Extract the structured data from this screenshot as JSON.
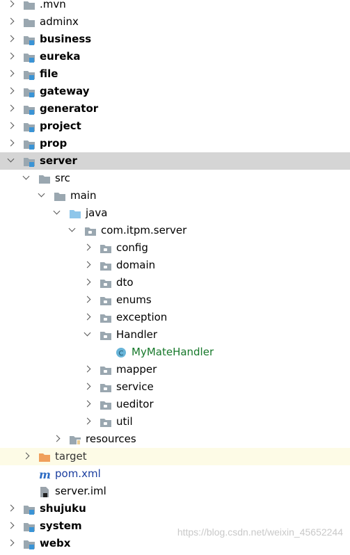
{
  "tree": {
    "rows": [
      {
        "label": "mvn",
        "display": ".mvn",
        "type": "folder",
        "expand": "collapsed",
        "level": 0,
        "bold": false
      },
      {
        "label": "adminx",
        "type": "folder",
        "expand": "collapsed",
        "level": 0,
        "bold": false
      },
      {
        "label": "business",
        "type": "module",
        "expand": "collapsed",
        "level": 0,
        "bold": true
      },
      {
        "label": "eureka",
        "type": "module",
        "expand": "collapsed",
        "level": 0,
        "bold": true
      },
      {
        "label": "file",
        "type": "module",
        "expand": "collapsed",
        "level": 0,
        "bold": true
      },
      {
        "label": "gateway",
        "type": "module",
        "expand": "collapsed",
        "level": 0,
        "bold": true
      },
      {
        "label": "generator",
        "type": "module",
        "expand": "collapsed",
        "level": 0,
        "bold": true
      },
      {
        "label": "project",
        "type": "module",
        "expand": "collapsed",
        "level": 0,
        "bold": true
      },
      {
        "label": "prop",
        "type": "module",
        "expand": "collapsed",
        "level": 0,
        "bold": true
      },
      {
        "label": "server",
        "type": "module",
        "expand": "expanded",
        "level": 0,
        "bold": true,
        "selected": true
      },
      {
        "label": "src",
        "type": "folder",
        "expand": "expanded",
        "level": 1,
        "bold": false
      },
      {
        "label": "main",
        "type": "folder",
        "expand": "expanded",
        "level": 2,
        "bold": false
      },
      {
        "label": "java",
        "type": "source",
        "expand": "expanded",
        "level": 3,
        "bold": false
      },
      {
        "label": "com.itpm.server",
        "type": "package",
        "expand": "expanded",
        "level": 4,
        "bold": false
      },
      {
        "label": "config",
        "type": "package",
        "expand": "collapsed",
        "level": 5,
        "bold": false
      },
      {
        "label": "domain",
        "type": "package",
        "expand": "collapsed",
        "level": 5,
        "bold": false
      },
      {
        "label": "dto",
        "type": "package",
        "expand": "collapsed",
        "level": 5,
        "bold": false
      },
      {
        "label": "enums",
        "type": "package",
        "expand": "collapsed",
        "level": 5,
        "bold": false
      },
      {
        "label": "exception",
        "type": "package",
        "expand": "collapsed",
        "level": 5,
        "bold": false
      },
      {
        "label": "Handler",
        "type": "package",
        "expand": "expanded",
        "level": 5,
        "bold": false
      },
      {
        "label": "MyMateHandler",
        "type": "class",
        "expand": "none",
        "level": 6,
        "bold": false,
        "color": "green"
      },
      {
        "label": "mapper",
        "type": "package",
        "expand": "collapsed",
        "level": 5,
        "bold": false
      },
      {
        "label": "service",
        "type": "package",
        "expand": "collapsed",
        "level": 5,
        "bold": false
      },
      {
        "label": "ueditor",
        "type": "package",
        "expand": "collapsed",
        "level": 5,
        "bold": false
      },
      {
        "label": "util",
        "type": "package",
        "expand": "collapsed",
        "level": 5,
        "bold": false
      },
      {
        "label": "resources",
        "type": "resources",
        "expand": "collapsed",
        "level": 3,
        "bold": false
      },
      {
        "label": "target",
        "type": "target",
        "expand": "collapsed",
        "level": 1,
        "bold": false,
        "excluded": true
      },
      {
        "label": "pom.xml",
        "type": "maven",
        "expand": "none",
        "level": 1,
        "bold": false,
        "color": "blue"
      },
      {
        "label": "server.iml",
        "type": "iml",
        "expand": "none",
        "level": 1,
        "bold": false
      },
      {
        "label": "shujuku",
        "type": "module",
        "expand": "collapsed",
        "level": 0,
        "bold": true
      },
      {
        "label": "system",
        "type": "module",
        "expand": "collapsed",
        "level": 0,
        "bold": true
      },
      {
        "label": "webx",
        "type": "module",
        "expand": "collapsed",
        "level": 0,
        "bold": true
      }
    ]
  },
  "watermark": "https://blog.csdn.net/weixin_45652244",
  "colors": {
    "folder": "#9aa7b0",
    "module_badge": "#3a94d6",
    "source_folder": "#8ec6ea",
    "class_icon": "#68b4d8",
    "target": "#f0a05c",
    "selected_bg": "#d5d5d5",
    "excluded_bg": "#fdfbe6"
  }
}
